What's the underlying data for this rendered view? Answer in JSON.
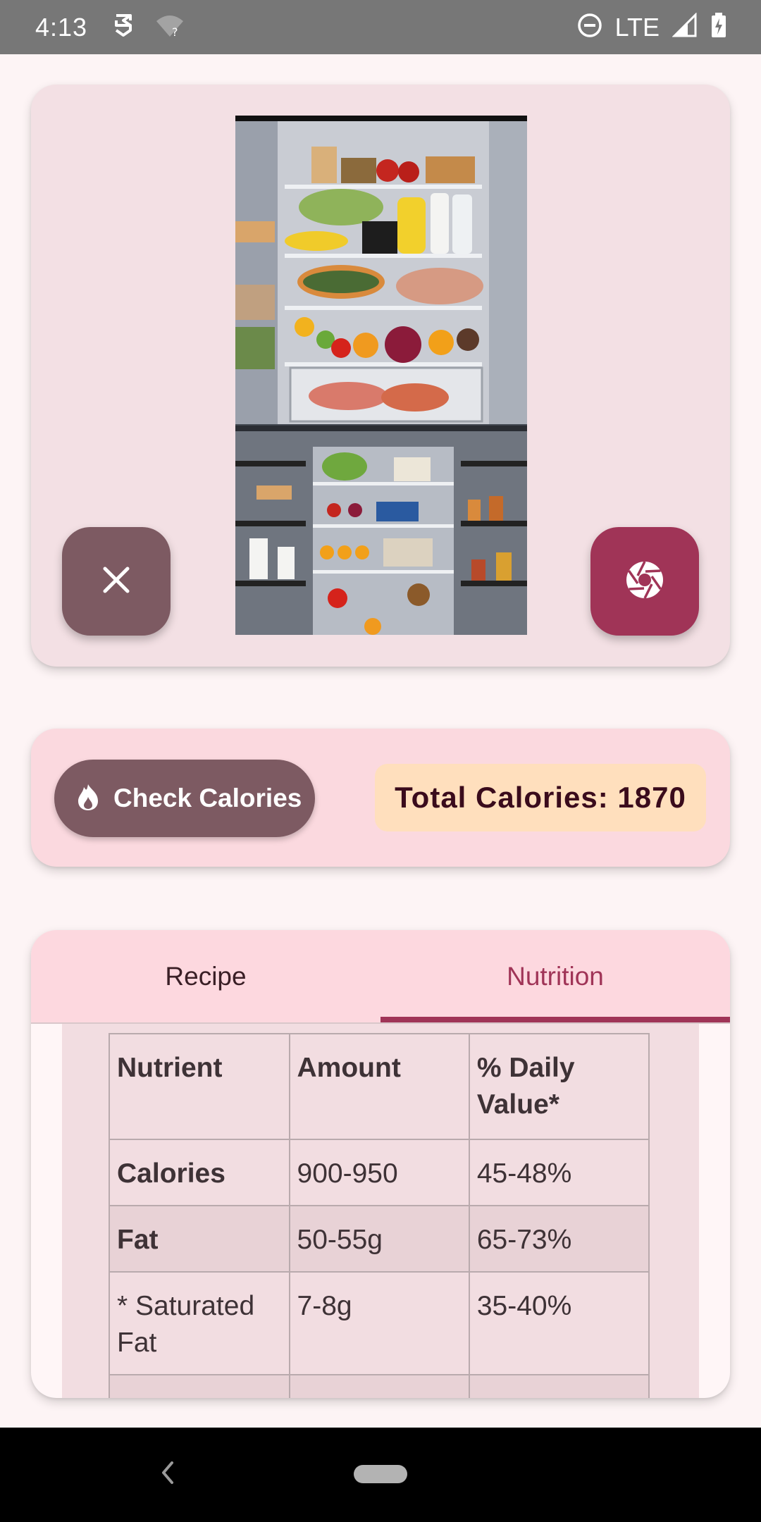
{
  "status_bar": {
    "time": "4:13",
    "network": "LTE",
    "icons": [
      "vpn-icon",
      "wifi-unknown-icon",
      "do-not-disturb-icon",
      "signal-icon",
      "battery-charging-icon"
    ]
  },
  "camera": {
    "image_alt": "Open refrigerator full of food",
    "close_icon": "close-icon",
    "shutter_icon": "camera-shutter-icon"
  },
  "calories": {
    "button_label": "Check Calories",
    "button_icon": "flame-icon",
    "total_text": "Total Calories: 1870"
  },
  "tabs": [
    {
      "label": "Recipe",
      "selected": false
    },
    {
      "label": "Nutrition",
      "selected": true
    }
  ],
  "nutrition_table": {
    "headers": [
      "Nutrient",
      "Amount",
      "% Daily Value*"
    ],
    "rows": [
      {
        "nutrient": "Calories",
        "amount": "900-950",
        "daily": "45-48%"
      },
      {
        "nutrient": "Fat",
        "amount": "50-55g",
        "daily": "65-73%"
      },
      {
        "nutrient": "* Saturated Fat",
        "amount": "7-8g",
        "daily": "35-40%"
      },
      {
        "nutrient": "",
        "amount": "",
        "daily": ""
      }
    ]
  },
  "colors": {
    "primary": "#a03457",
    "secondary": "#7d5a62",
    "chip": "#ffdfbd",
    "status_bar": "#777777"
  }
}
